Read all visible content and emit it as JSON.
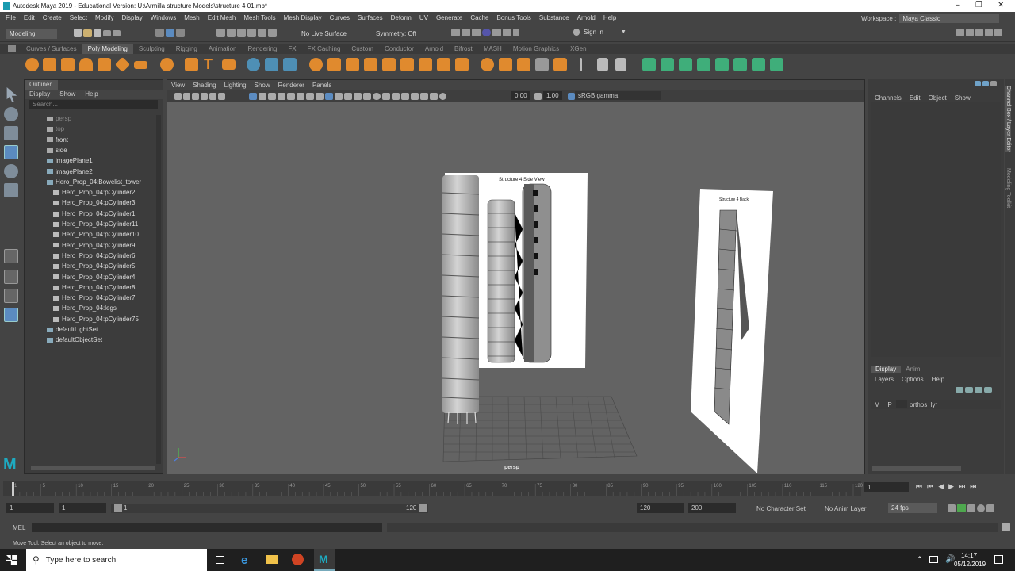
{
  "window": {
    "title": "Autodesk Maya 2019 - Educational Version: U:\\Armilla structure Models\\structure 4 01.mb*"
  },
  "menus": [
    "File",
    "Edit",
    "Create",
    "Select",
    "Modify",
    "Display",
    "Windows",
    "Mesh",
    "Edit Mesh",
    "Mesh Tools",
    "Mesh Display",
    "Curves",
    "Surfaces",
    "Deform",
    "UV",
    "Generate",
    "Cache",
    "Bonus Tools",
    "Substance",
    "Arnold",
    "Help"
  ],
  "workspace": {
    "label": "Workspace :",
    "value": "Maya Classic"
  },
  "status_line": {
    "mode": "Modeling",
    "live_surface": "No Live Surface",
    "symmetry": "Symmetry: Off",
    "sign_in": "Sign In"
  },
  "shelf_tabs": [
    "Curves / Surfaces",
    "Poly Modeling",
    "Sculpting",
    "Rigging",
    "Animation",
    "Rendering",
    "FX",
    "FX Caching",
    "Custom",
    "Conductor",
    "Arnold",
    "Bifrost",
    "MASH",
    "Motion Graphics",
    "XGen"
  ],
  "shelf_active": "Poly Modeling",
  "outliner": {
    "title": "Outliner",
    "menu": [
      "Display",
      "Show",
      "Help"
    ],
    "search": "Search...",
    "items": [
      {
        "label": "persp",
        "indent": 0,
        "dim": true
      },
      {
        "label": "top",
        "indent": 0,
        "dim": true
      },
      {
        "label": "front",
        "indent": 0,
        "dim": false
      },
      {
        "label": "side",
        "indent": 0,
        "dim": false
      },
      {
        "label": "imagePlane1",
        "indent": 0,
        "dim": false
      },
      {
        "label": "imagePlane2",
        "indent": 0,
        "dim": false
      },
      {
        "label": "Hero_Prop_04:Bowelist_tower",
        "indent": 0,
        "dim": false
      },
      {
        "label": "Hero_Prop_04:pCylinder2",
        "indent": 1,
        "dim": false
      },
      {
        "label": "Hero_Prop_04:pCylinder3",
        "indent": 1,
        "dim": false
      },
      {
        "label": "Hero_Prop_04:pCylinder1",
        "indent": 1,
        "dim": false
      },
      {
        "label": "Hero_Prop_04:pCylinder11",
        "indent": 1,
        "dim": false
      },
      {
        "label": "Hero_Prop_04:pCylinder10",
        "indent": 1,
        "dim": false
      },
      {
        "label": "Hero_Prop_04:pCylinder9",
        "indent": 1,
        "dim": false
      },
      {
        "label": "Hero_Prop_04:pCylinder6",
        "indent": 1,
        "dim": false
      },
      {
        "label": "Hero_Prop_04:pCylinder5",
        "indent": 1,
        "dim": false
      },
      {
        "label": "Hero_Prop_04:pCylinder4",
        "indent": 1,
        "dim": false
      },
      {
        "label": "Hero_Prop_04:pCylinder8",
        "indent": 1,
        "dim": false
      },
      {
        "label": "Hero_Prop_04:pCylinder7",
        "indent": 1,
        "dim": false
      },
      {
        "label": "Hero_Prop_04:legs",
        "indent": 1,
        "dim": false
      },
      {
        "label": "Hero_Prop_04:pCylinder75",
        "indent": 1,
        "dim": false
      },
      {
        "label": "defaultLightSet",
        "indent": 0,
        "dim": false
      },
      {
        "label": "defaultObjectSet",
        "indent": 0,
        "dim": false
      }
    ]
  },
  "viewport": {
    "menu": [
      "View",
      "Shading",
      "Lighting",
      "Show",
      "Renderer",
      "Panels"
    ],
    "exposure": "0.00",
    "gamma": "1.00",
    "color_space": "sRGB gamma",
    "camera_label": "persp",
    "image1_title": "Structure 4 Side View",
    "image2_title": "Structure 4 Back"
  },
  "channel_box": {
    "menu": [
      "Channels",
      "Edit",
      "Object",
      "Show"
    ],
    "side_tabs": [
      "Channel Box / Layer Editor",
      "Modeling Toolkit"
    ]
  },
  "layer_editor": {
    "tabs": [
      "Display",
      "Anim"
    ],
    "menu": [
      "Layers",
      "Options",
      "Help"
    ],
    "layer": {
      "v": "V",
      "p": "P",
      "name": "orthos_lyr"
    }
  },
  "timeline": {
    "ticks": [
      "1",
      "5",
      "10",
      "15",
      "20",
      "25",
      "30",
      "35",
      "40",
      "45",
      "50",
      "55",
      "60",
      "65",
      "70",
      "75",
      "80",
      "85",
      "90",
      "95",
      "100",
      "105",
      "110",
      "115",
      "120"
    ],
    "current_frame": "1"
  },
  "range": {
    "start": "1",
    "start2": "1",
    "slider_start": "1",
    "slider_end": "120",
    "end": "120",
    "end2": "200",
    "character_set": "No Character Set",
    "anim_layer": "No Anim Layer",
    "fps": "24 fps"
  },
  "cmd": {
    "label": "MEL"
  },
  "help_line": "Move Tool: Select an object to move.",
  "taskbar": {
    "search": "Type here to search",
    "time": "14:17",
    "date": "05/12/2019"
  }
}
